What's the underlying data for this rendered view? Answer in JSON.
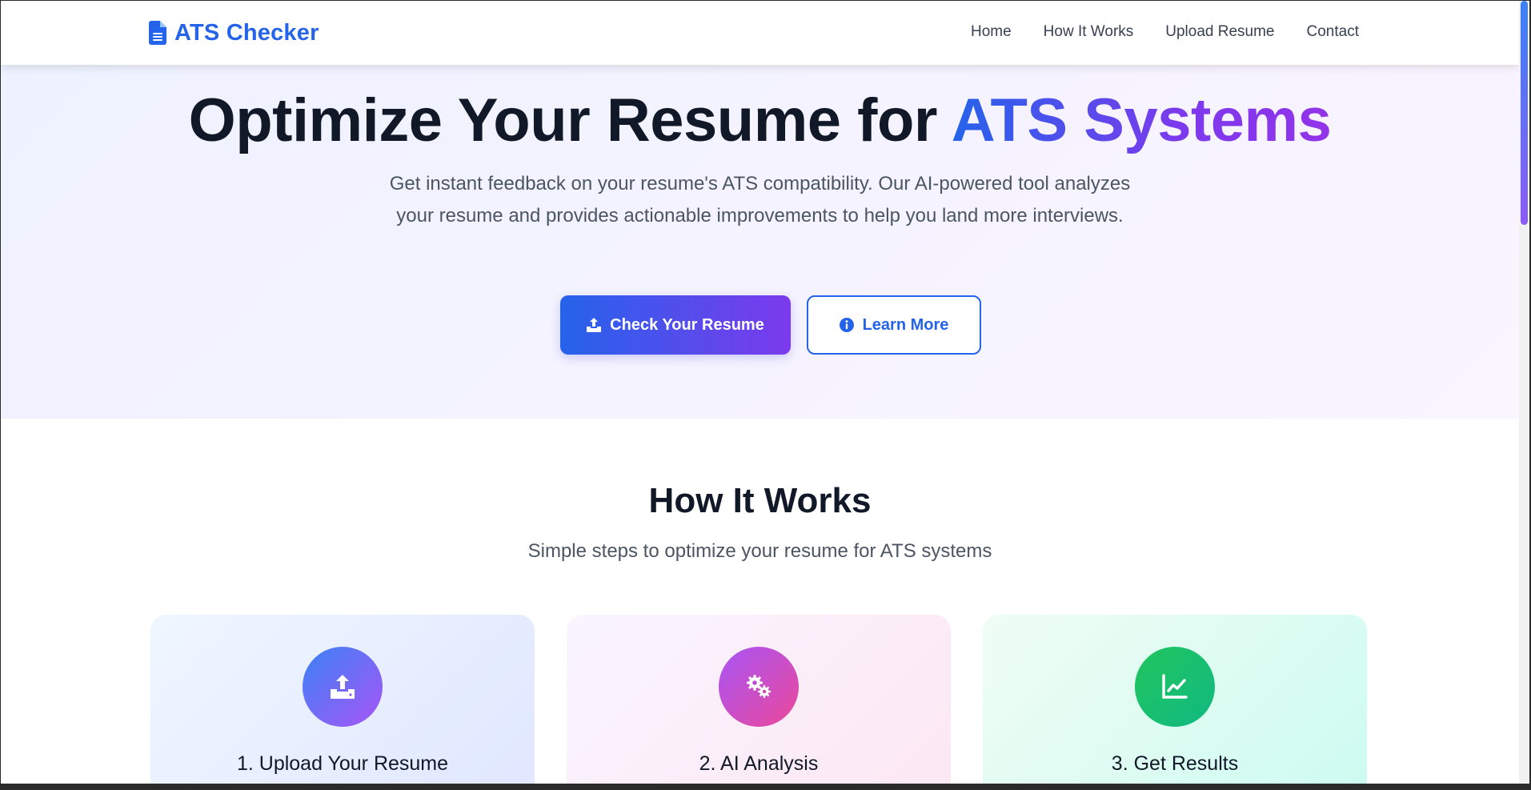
{
  "brand": {
    "name": "ATS Checker",
    "icon": "file-alt-icon"
  },
  "nav": {
    "items": [
      {
        "label": "Home"
      },
      {
        "label": "How It Works"
      },
      {
        "label": "Upload Resume"
      },
      {
        "label": "Contact"
      }
    ]
  },
  "hero": {
    "title_prefix": "Optimize Your Resume for ",
    "title_highlight": "ATS Systems",
    "subtitle": "Get instant feedback on your resume's ATS compatibility. Our AI-powered tool analyzes your resume and provides actionable improvements to help you land more interviews.",
    "primary_button": {
      "label": "Check Your Resume",
      "icon": "upload-icon"
    },
    "secondary_button": {
      "label": "Learn More",
      "icon": "info-circle-icon"
    }
  },
  "how_it_works": {
    "title": "How It Works",
    "subtitle": "Simple steps to optimize your resume for ATS systems",
    "steps": [
      {
        "title": "1. Upload Your Resume",
        "icon": "upload-icon"
      },
      {
        "title": "2. AI Analysis",
        "icon": "cogs-icon"
      },
      {
        "title": "3. Get Results",
        "icon": "chart-line-icon"
      }
    ]
  },
  "colors": {
    "brand": "#2563eb",
    "accent_purple": "#7c3aed",
    "text_dark": "#111827",
    "text_muted": "#4b5563"
  }
}
